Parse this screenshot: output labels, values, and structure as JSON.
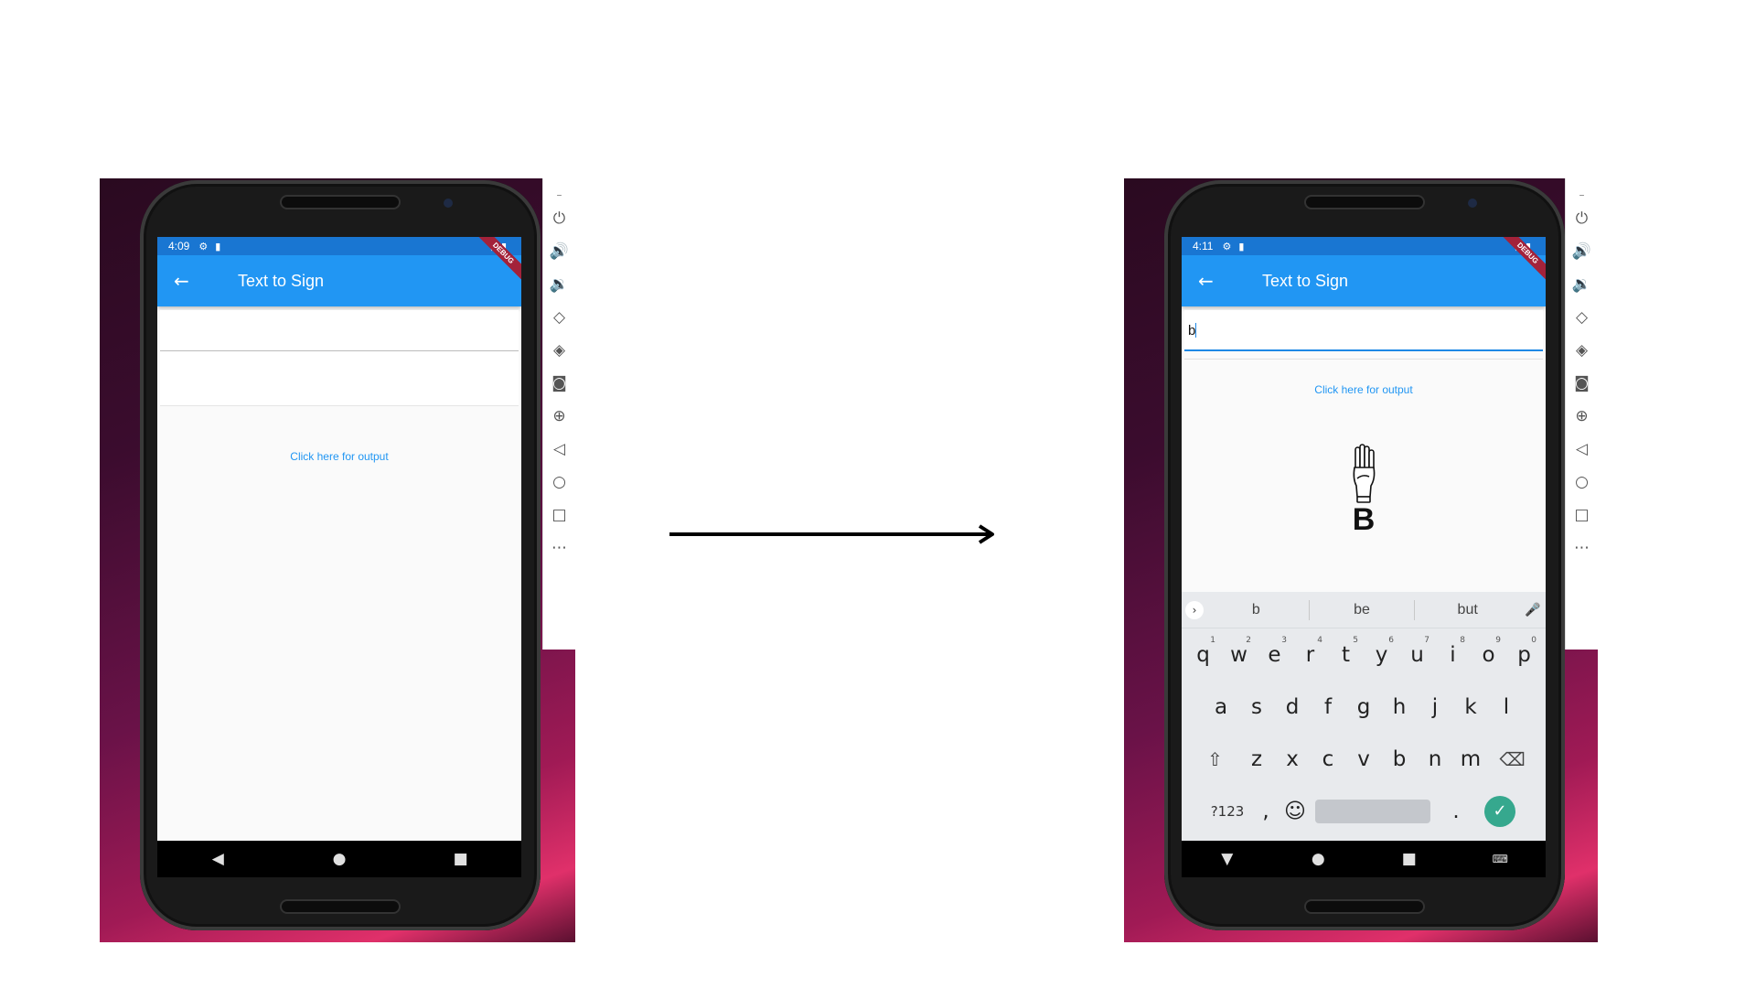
{
  "colors": {
    "app_bar": "#2196f3",
    "status_bar": "#1976d2",
    "link": "#2196f3",
    "focus_underline": "#1e88e5",
    "enter_key": "#36a88e"
  },
  "left_phone": {
    "status": {
      "time": "4:09",
      "left_icons": [
        "gear-icon",
        "sd-card-icon"
      ],
      "right_icons": [
        "wifi-icon",
        "battery-icon"
      ]
    },
    "debug_banner": "DEBUG",
    "app_bar": {
      "back_icon": "back-arrow-icon",
      "title": "Text to Sign"
    },
    "text_field": {
      "value": ""
    },
    "output_link": "Click here for output",
    "nav": {
      "back": "◀",
      "home": "●",
      "recents": "■"
    }
  },
  "right_phone": {
    "status": {
      "time": "4:11",
      "left_icons": [
        "gear-icon",
        "sd-card-icon"
      ],
      "right_icons": [
        "wifi-icon",
        "battery-icon"
      ]
    },
    "debug_banner": "DEBUG",
    "app_bar": {
      "back_icon": "back-arrow-icon",
      "title": "Text to Sign"
    },
    "text_field": {
      "value": "b"
    },
    "output_link": "Click here for output",
    "sign_output": {
      "image": "asl-hand-sign-b-icon",
      "letter": "B"
    },
    "keyboard": {
      "suggestions": [
        "b",
        "be",
        "but"
      ],
      "row1": [
        {
          "key": "q",
          "num": "1"
        },
        {
          "key": "w",
          "num": "2"
        },
        {
          "key": "e",
          "num": "3"
        },
        {
          "key": "r",
          "num": "4"
        },
        {
          "key": "t",
          "num": "5"
        },
        {
          "key": "y",
          "num": "6"
        },
        {
          "key": "u",
          "num": "7"
        },
        {
          "key": "i",
          "num": "8"
        },
        {
          "key": "o",
          "num": "9"
        },
        {
          "key": "p",
          "num": "0"
        }
      ],
      "row2": [
        "a",
        "s",
        "d",
        "f",
        "g",
        "h",
        "j",
        "k",
        "l"
      ],
      "row3": [
        "z",
        "x",
        "c",
        "v",
        "b",
        "n",
        "m"
      ],
      "bottom": {
        "symbols": "?123",
        "comma": ",",
        "period": "."
      }
    },
    "nav": {
      "back": "▼",
      "home": "●",
      "recents": "■"
    }
  },
  "emulator_toolbar": [
    "power-icon",
    "volume-up-icon",
    "volume-down-icon",
    "rotate-left-icon",
    "rotate-right-icon",
    "camera-icon",
    "zoom-icon",
    "back-icon",
    "home-icon",
    "overview-icon",
    "more-icon"
  ]
}
